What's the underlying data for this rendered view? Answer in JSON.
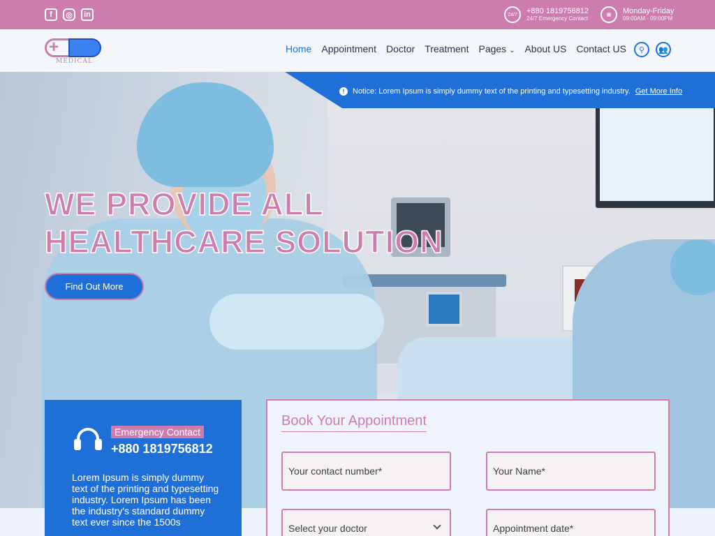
{
  "topbar": {
    "social": [
      "facebook-icon",
      "instagram-icon",
      "linkedin-icon"
    ],
    "phone": "+880 1819756812",
    "phone_caption": "24/7 Emergency Contact",
    "phone_icon_text": "24/7",
    "hours_title": "Monday-Friday",
    "hours_time": "09:00AM - 09:00PM"
  },
  "nav": {
    "logo_word": "MEDICAL",
    "items": [
      "Home",
      "Appointment",
      "Doctor",
      "Treatment",
      "Pages",
      "About US",
      "Contact US"
    ],
    "active": "Home"
  },
  "hero": {
    "notice_text": "Notice: Lorem Ipsum is simply dummy text of the printing and typesetting industry.",
    "notice_link": "Get More Info",
    "headline_line1": "WE PROVIDE ALL",
    "headline_line2": "HEALTHCARE SOLUTION",
    "cta": "Find Out More"
  },
  "emergency": {
    "tag": "Emergency Contact",
    "phone": "+880 1819756812",
    "description": "Lorem Ipsum is simply dummy text of the printing and typesetting industry. Lorem Ipsum has been the industry's standard dummy text ever since the 1500s"
  },
  "appointment": {
    "title": "Book Your Appointment",
    "contact_placeholder": "Your contact number*",
    "name_placeholder": "Your Name*",
    "doctor_select": "Select your doctor",
    "date_placeholder": "Appointment date*"
  },
  "colors": {
    "accent_pink": "#cd7cae",
    "primary_blue": "#1f6fd8"
  }
}
